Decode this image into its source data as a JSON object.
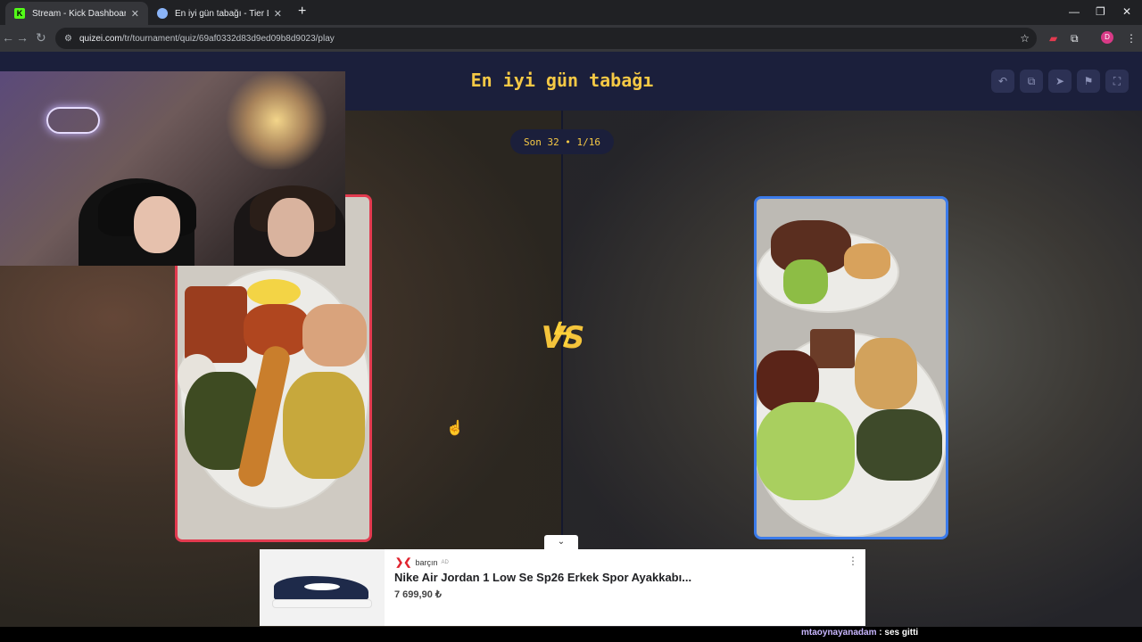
{
  "browser": {
    "tabs": [
      {
        "title": "Stream - Kick Dashboard",
        "favicon": "kick-icon"
      },
      {
        "title": "En iyi gün tabağı - Tier List, Kör",
        "favicon": "quizei-icon"
      }
    ],
    "url_host": "quizei.com",
    "url_path": "/tr/tournament/quiz/69af0332d83d9ed09b8d9023/play",
    "profile_initial": "D"
  },
  "quiz": {
    "title": "En iyi gün tabağı",
    "round": "Son 32 • 1/16",
    "vs_label": "VS",
    "left_border_color": "#e23a4f",
    "right_border_color": "#3b7bea",
    "accent": "#f6c945"
  },
  "header_actions": [
    "undo-icon",
    "share-icon",
    "send-icon",
    "flag-icon",
    "fullscreen-icon"
  ],
  "ad": {
    "brand": "barçın",
    "ad_tag": "AD",
    "title": "Nike Air Jordan 1 Low Se Sp26 Erkek Spor Ayakkabı...",
    "price": "7 699,90 ₺"
  },
  "chat": {
    "user": "mtaoynayanadam",
    "separator": ":",
    "message": "ses gitti"
  }
}
